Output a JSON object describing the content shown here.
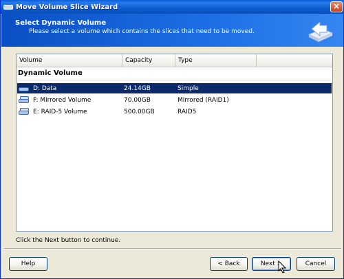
{
  "window": {
    "title": "Move Volume Slice Wizard"
  },
  "header": {
    "title": "Select Dynamic Volume",
    "subtitle": "Please select a volume which contains the slices that need to be moved."
  },
  "list": {
    "columns": [
      "Volume",
      "Capacity",
      "Type",
      ""
    ],
    "group_title": "Dynamic Volume",
    "rows": [
      {
        "name": "D: Data",
        "capacity": "24.14GB",
        "type": "Simple",
        "selected": true,
        "icon": "single-disk-icon"
      },
      {
        "name": "F: Mirrored Volume",
        "capacity": "70.00GB",
        "type": "Mirrored (RAID1)",
        "selected": false,
        "icon": "mirrored-disk-icon"
      },
      {
        "name": "E: RAID-5 Volume",
        "capacity": "500.00GB",
        "type": "RAID5",
        "selected": false,
        "icon": "raid-disk-icon"
      }
    ]
  },
  "footer": {
    "message": "Click the Next button to continue."
  },
  "buttons": {
    "help": "Help",
    "help_accel": "H",
    "back": "< Back",
    "back_accel": "B",
    "next": "Next >",
    "next_accel": "N",
    "cancel": "Cancel"
  },
  "colors": {
    "titlebar": "#0a5fd8",
    "header": "#0b4fc4",
    "selection": "#0b2a6b",
    "window_bg": "#ece9d8"
  }
}
